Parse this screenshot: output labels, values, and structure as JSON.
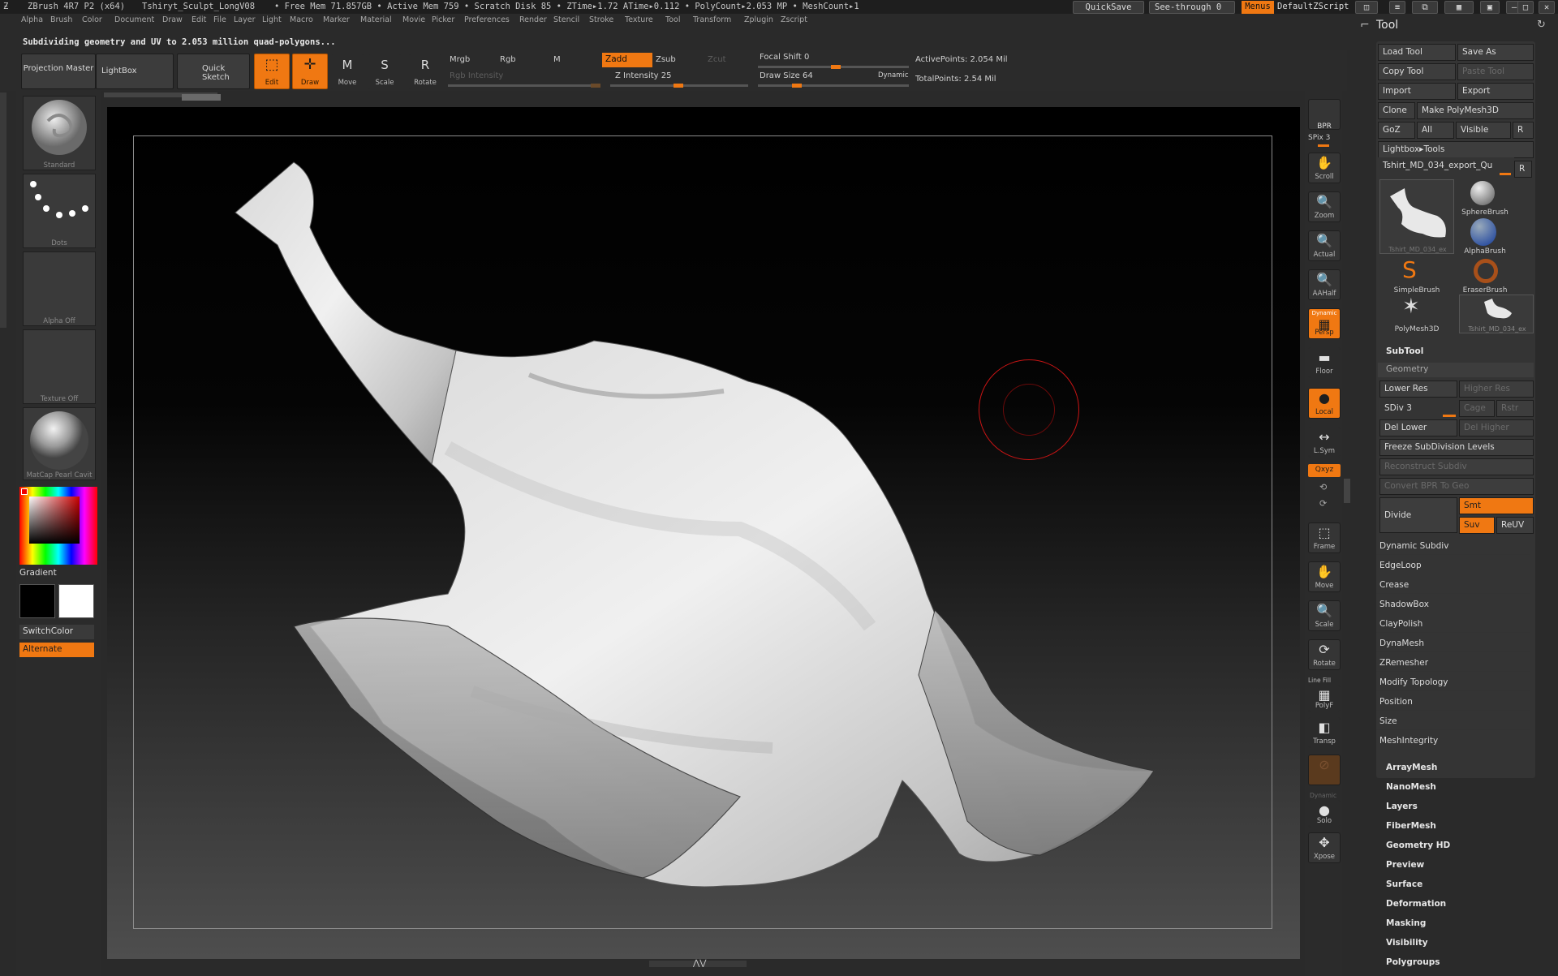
{
  "titlebar": {
    "app": "ZBrush 4R7 P2 (x64)",
    "file": "Tshiryt_Sculpt_LongV08",
    "stats": "• Free Mem 71.857GB • Active Mem 759 • Scratch Disk 85 • ZTime▸1.72 ATime▸0.112 • PolyCount▸2.053 MP • MeshCount▸1",
    "quicksave": "QuickSave",
    "seethrough": "See-through  0",
    "menus": "Menus",
    "defaultzscript": "DefaultZScript"
  },
  "menubar": [
    "Alpha",
    "Brush",
    "Color",
    "Document",
    "Draw",
    "Edit",
    "File",
    "Layer",
    "Light",
    "Macro",
    "Marker",
    "Material",
    "Movie",
    "Picker",
    "Preferences",
    "Render",
    "Stencil",
    "Stroke",
    "Texture",
    "Tool",
    "Transform",
    "Zplugin",
    "Zscript"
  ],
  "notice": "Subdividing geometry and UV to 2.053 million quad-polygons...",
  "toolbar": {
    "projection_master": "Projection Master",
    "lightbox": "LightBox",
    "quick_sketch": "Quick Sketch",
    "edit": "Edit",
    "draw": "Draw",
    "move": "Move",
    "scale": "Scale",
    "rotate": "Rotate",
    "mrgb": "Mrgb",
    "rgb": "Rgb",
    "m": "M",
    "rgb_intensity": "Rgb Intensity",
    "zadd": "Zadd",
    "zsub": "Zsub",
    "zcut": "Zcut",
    "z_intensity": "Z Intensity 25",
    "focal_shift": "Focal Shift 0",
    "draw_size": "Draw Size 64",
    "dynamic": "Dynamic",
    "active_points": "ActivePoints: 2.054  Mil",
    "total_points": "TotalPoints: 2.54  Mil"
  },
  "leftshelf": {
    "brush": "Standard",
    "stroke": "Dots",
    "alpha": "Alpha  Off",
    "texture": "Texture  Off",
    "material": "MatCap Pearl Cavit",
    "gradient": "Gradient",
    "switchcolor": "SwitchColor",
    "alternate": "Alternate"
  },
  "rightshelf": [
    {
      "icon": "BPR",
      "label": ""
    },
    {
      "icon": "",
      "label": "SPix 3"
    },
    {
      "icon": "✋",
      "label": "Scroll"
    },
    {
      "icon": "🔍",
      "label": "Zoom"
    },
    {
      "icon": "🔍",
      "label": "Actual"
    },
    {
      "icon": "🔍",
      "label": "AAHalf"
    },
    {
      "icon": "▦",
      "label": "Persp"
    },
    {
      "icon": "▬",
      "label": "Floor"
    },
    {
      "icon": "●",
      "label": "Local"
    },
    {
      "icon": "↔",
      "label": "L.Sym"
    },
    {
      "icon": "",
      "label": "Qxyz"
    },
    {
      "icon": "⬚",
      "label": "Frame"
    },
    {
      "icon": "✋",
      "label": "Move"
    },
    {
      "icon": "🔍",
      "label": "Scale"
    },
    {
      "icon": "⟳",
      "label": "Rotate"
    },
    {
      "icon": "▦",
      "label": "PolyF"
    },
    {
      "icon": "◧",
      "label": "Transp"
    },
    {
      "icon": "●",
      "label": "Solo"
    },
    {
      "icon": "✥",
      "label": "Xpose"
    }
  ],
  "rightshelf_extra": {
    "dynamic": "Dynamic",
    "line_fill": "Line Fill",
    "dynamic2": "Dynamic"
  },
  "toolpanel": {
    "title": "Tool",
    "load_tool": "Load Tool",
    "save_as": "Save As",
    "copy_tool": "Copy Tool",
    "paste_tool": "Paste Tool",
    "import": "Import",
    "export": "Export",
    "clone": "Clone",
    "make_polymesh": "Make PolyMesh3D",
    "goz": "GoZ",
    "all": "All",
    "visible": "Visible",
    "r": "R",
    "lightbox_tools": "Lightbox▸Tools",
    "current_tool": "Tshirt_MD_034_export_Qu",
    "thumb_current": "Tshirt_MD_034_ex",
    "sphere": "SphereBrush",
    "alpha": "AlphaBrush",
    "simple": "SimpleBrush",
    "eraser": "EraserBrush",
    "polymesh": "PolyMesh3D",
    "thumb_tshirt": "Tshirt_MD_034_ex",
    "subtool": "SubTool",
    "geometry": "Geometry",
    "lower_res": "Lower Res",
    "higher_res": "Higher Res",
    "sdiv": "SDiv 3",
    "cage": "Cage",
    "rstr": "Rstr",
    "del_lower": "Del Lower",
    "del_higher": "Del Higher",
    "freeze": "Freeze SubDivision Levels",
    "reconstruct": "Reconstruct Subdiv",
    "convert_bpr": "Convert BPR To Geo",
    "divide": "Divide",
    "smt": "Smt",
    "suv": "Suv",
    "reuv": "ReUV",
    "geo_items": [
      "Dynamic Subdiv",
      "EdgeLoop",
      "Crease",
      "ShadowBox",
      "ClayPolish",
      "DynaMesh",
      "ZRemesher",
      "Modify Topology",
      "Position",
      "Size",
      "MeshIntegrity"
    ],
    "sections": [
      "ArrayMesh",
      "NanoMesh",
      "Layers",
      "FiberMesh",
      "Geometry HD",
      "Preview",
      "Surface",
      "Deformation",
      "Masking",
      "Visibility",
      "Polygroups"
    ]
  },
  "colors": {
    "accent": "#f07812",
    "brush_ring": "#c81414"
  }
}
